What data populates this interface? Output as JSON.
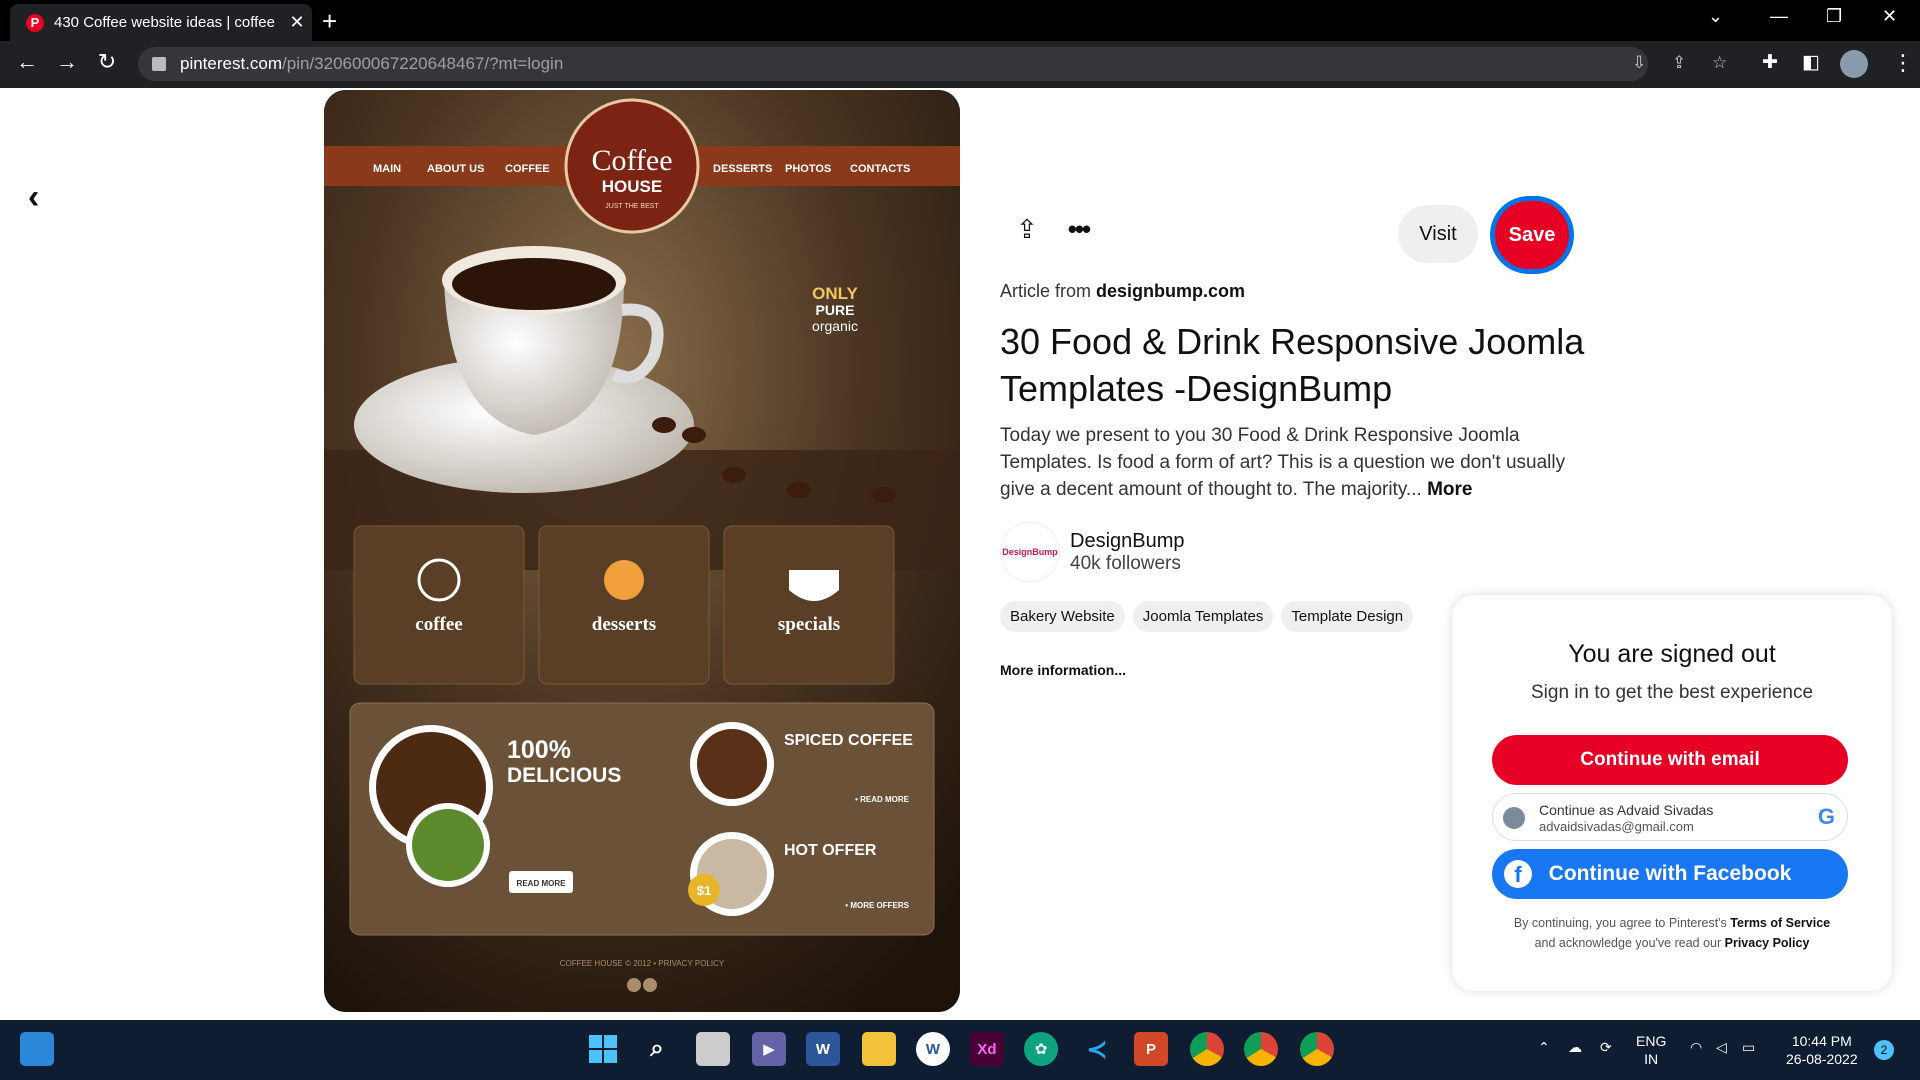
{
  "browser": {
    "tab_title": "430 Coffee website ideas | coffee",
    "tab_favicon": "P",
    "url_host": "pinterest.com",
    "url_path": "/pin/320600067220648467/?mt=login"
  },
  "pin": {
    "visit_label": "Visit",
    "save_label": "Save",
    "article_prefix": "Article from",
    "article_source": "designbump.com",
    "title": "30 Food & Drink Responsive Joomla Templates -DesignBump",
    "description": "Today we present to you 30 Food & Drink Responsive Joomla Templates. Is food a form of art? This is a question we don't usually give a decent amount of thought to. The majority...",
    "more_label": "More",
    "creator_name": "DesignBump",
    "creator_logo_text": "DesignBump",
    "creator_followers": "40k followers",
    "tags": [
      "Bakery Website",
      "Joomla Templates",
      "Template Design"
    ],
    "more_information": "More information..."
  },
  "image": {
    "nav_left": [
      "MAIN",
      "ABOUT US",
      "COFFEE"
    ],
    "nav_right": [
      "DESSERTS",
      "PHOTOS",
      "CONTACTS"
    ],
    "logo_line1": "Coffee",
    "logo_line2": "HOUSE",
    "logo_tag": "JUST THE BEST",
    "only_line1": "ONLY",
    "only_line2": "PURE",
    "only_line3": "organic",
    "tiles": [
      "coffee",
      "desserts",
      "specials"
    ],
    "promo_title1": "100%",
    "promo_title2": "DELICIOUS",
    "read_more": "READ MORE",
    "spiced": "SPICED COFFEE",
    "spiced_link": "• READ MORE",
    "hot": "HOT OFFER",
    "hot_link": "• MORE OFFERS",
    "price": "$1",
    "footer": "COFFEE HOUSE © 2012 • PRIVACY POLICY"
  },
  "modal": {
    "heading": "You are signed out",
    "subheading": "Sign in to get the best experience",
    "email_button": "Continue with email",
    "google_line1": "Continue as Advaid Sivadas",
    "google_line2": "advaidsivadas@gmail.com",
    "google_icon": "G",
    "facebook_button": "Continue with Facebook",
    "facebook_icon": "f",
    "terms_prefix": "By continuing, you agree to Pinterest's",
    "terms_link": "Terms of Service",
    "terms_mid": "and acknowledge you've read our",
    "privacy_link": "Privacy Policy"
  },
  "taskbar": {
    "lang1": "ENG",
    "lang2": "IN",
    "time": "10:44 PM",
    "date": "26-08-2022",
    "notif_count": "2",
    "apps": [
      "start",
      "search",
      "file-explorer",
      "teams",
      "word",
      "folder",
      "wordpad",
      "xd",
      "chatgpt",
      "vscode",
      "powerpoint",
      "chrome",
      "chrome",
      "chrome"
    ]
  },
  "colors": {
    "pinterest_red": "#e60023",
    "facebook_blue": "#1877f2",
    "focus_ring": "#0074e8"
  }
}
